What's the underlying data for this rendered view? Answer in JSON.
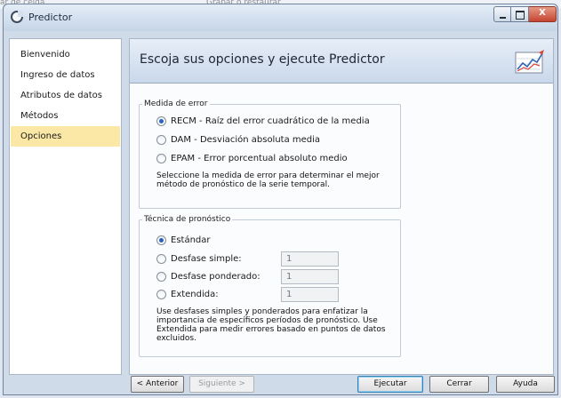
{
  "background": {
    "fragments": [
      "ar de celda",
      "Grabar o restaurar"
    ]
  },
  "window": {
    "title": "Predictor",
    "icon": "app-logo-icon",
    "close_glyph": "X"
  },
  "sidebar": {
    "items": [
      {
        "label": "Bienvenido"
      },
      {
        "label": "Ingreso de datos"
      },
      {
        "label": "Atributos de datos"
      },
      {
        "label": "Métodos"
      },
      {
        "label": "Opciones"
      }
    ],
    "selected_index": 4,
    "selected_color": "#fbe8a6"
  },
  "main": {
    "header_title": "Escoja sus opciones y ejecute Predictor",
    "header_icon": "trend-chart-icon",
    "error_group": {
      "legend": "Medida de error",
      "options": [
        {
          "label": "RECM - Raíz del error cuadrático de la media",
          "checked": true
        },
        {
          "label": "DAM - Desviación absoluta media",
          "checked": false
        },
        {
          "label": "EPAM - Error porcentual absoluto medio",
          "checked": false
        }
      ],
      "description_lines": [
        "Seleccione la medida de error para determinar el mejor",
        "método de pronóstico de la serie temporal."
      ]
    },
    "technique_group": {
      "legend": "Técnica de pronóstico",
      "options": [
        {
          "label": "Estándar",
          "checked": true
        },
        {
          "label": "Desfase simple:",
          "checked": false,
          "value": "1"
        },
        {
          "label": "Desfase ponderado:",
          "checked": false,
          "value": "1"
        },
        {
          "label": "Extendida:",
          "checked": false,
          "value": "1"
        }
      ],
      "description_lines": [
        "Use desfases simples y ponderados para enfatizar la",
        "importancia de específicos períodos de pronóstico.  Use",
        "Extendida para medir errores basado en puntos de datos",
        "excluidos."
      ]
    }
  },
  "footer": {
    "back_label": "< Anterior",
    "next_label": "Siguiente >",
    "run_label": "Ejecutar",
    "close_label": "Cerrar",
    "help_label": "Ayuda"
  },
  "colors": {
    "accent": "#2a62c0",
    "header_gradient_top": "#e7eef7",
    "header_gradient_bottom": "#c9d8eb"
  }
}
